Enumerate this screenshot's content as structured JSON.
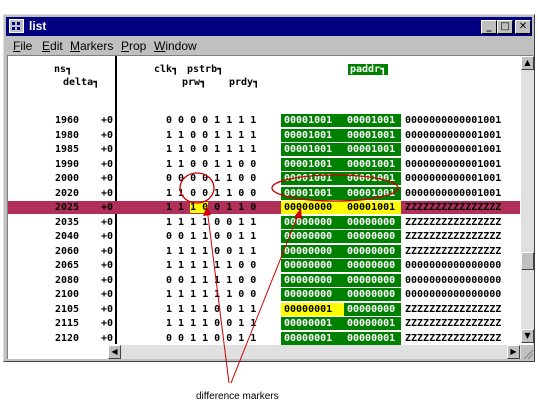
{
  "window": {
    "title": "list"
  },
  "menu": [
    {
      "label": "File",
      "u": "F",
      "rest": "ile"
    },
    {
      "label": "Edit",
      "u": "E",
      "rest": "dit"
    },
    {
      "label": "Markers",
      "u": "M",
      "rest": "arkers"
    },
    {
      "label": "Prop",
      "u": "P",
      "rest": "rop"
    },
    {
      "label": "Window",
      "u": "W",
      "rest": "indow"
    }
  ],
  "headers": {
    "ns": "ns",
    "delta": "delta",
    "clk": "clk",
    "pstrb": "pstrb",
    "prw": "prw",
    "prdy": "prdy",
    "paddr": "paddr"
  },
  "rows": [
    {
      "ns": "1960",
      "delta": "+0",
      "bits": "0 0 0 0 1 1 1 1",
      "b1": "00001001",
      "b2": "00001001",
      "z": "0000000000001001"
    },
    {
      "ns": "1980",
      "delta": "+0",
      "bits": "1 1 0 0 1 1 1 1",
      "b1": "00001001",
      "b2": "00001001",
      "z": "0000000000001001"
    },
    {
      "ns": "1985",
      "delta": "+0",
      "bits": "1 1 0 0 1 1 1 1",
      "b1": "00001001",
      "b2": "00001001",
      "z": "0000000000001001"
    },
    {
      "ns": "1990",
      "delta": "+0",
      "bits": "1 1 0 0 1 1 0 0",
      "b1": "00001001",
      "b2": "00001001",
      "z": "0000000000001001"
    },
    {
      "ns": "2000",
      "delta": "+0",
      "bits": "0 0 0 0 1 1 0 0",
      "b1": "00001001",
      "b2": "00001001",
      "z": "0000000000001001"
    },
    {
      "ns": "2020",
      "delta": "+0",
      "bits": "1 1 0 0 1 1 0 0",
      "b1": "00001001",
      "b2": "00001001",
      "z": "0000000000001001"
    },
    {
      "ns": "2025",
      "delta": "+0",
      "bits": "1 1 1 0 0 1 1 0",
      "b1": "00000000",
      "b2": "00001001",
      "z": "ZZZZZZZZZZZZZZZZ",
      "highlight": true
    },
    {
      "ns": "2035",
      "delta": "+0",
      "bits": "1 1 1 1 0 0 1 1",
      "b1": "00000000",
      "b2": "00000000",
      "z": "ZZZZZZZZZZZZZZZZ"
    },
    {
      "ns": "2040",
      "delta": "+0",
      "bits": "0 0 1 1 0 0 1 1",
      "b1": "00000000",
      "b2": "00000000",
      "z": "ZZZZZZZZZZZZZZZZ"
    },
    {
      "ns": "2060",
      "delta": "+0",
      "bits": "1 1 1 1 0 0 1 1",
      "b1": "00000000",
      "b2": "00000000",
      "z": "ZZZZZZZZZZZZZZZZ"
    },
    {
      "ns": "2065",
      "delta": "+0",
      "bits": "1 1 1 1 1 1 0 0",
      "b1": "00000000",
      "b2": "00000000",
      "z": "0000000000000000"
    },
    {
      "ns": "2080",
      "delta": "+0",
      "bits": "0 0 1 1 1 1 0 0",
      "b1": "00000000",
      "b2": "00000000",
      "z": "0000000000000000"
    },
    {
      "ns": "2100",
      "delta": "+0",
      "bits": "1 1 1 1 1 1 0 0",
      "b1": "00000000",
      "b2": "00000000",
      "z": "0000000000000000"
    },
    {
      "ns": "2105",
      "delta": "+0",
      "bits": "1 1 1 1 0 0 1 1",
      "b1": "00000001",
      "b2": "00000000",
      "z": "ZZZZZZZZZZZZZZZZ",
      "yellow": true
    },
    {
      "ns": "2115",
      "delta": "+0",
      "bits": "1 1 1 1 0 0 1 1",
      "b1": "00000001",
      "b2": "00000001",
      "z": "ZZZZZZZZZZZZZZZZ"
    },
    {
      "ns": "2120",
      "delta": "+0",
      "bits": "0 0 1 1 0 0 1 1",
      "b1": "00000001",
      "b2": "00000001",
      "z": "ZZZZZZZZZZZZZZZZ"
    }
  ],
  "callout": "difference markers",
  "colors": {
    "titlebar": "#000080",
    "bus": "#008000",
    "diff": "#ffff00",
    "cursor_row": "#b0305a"
  }
}
